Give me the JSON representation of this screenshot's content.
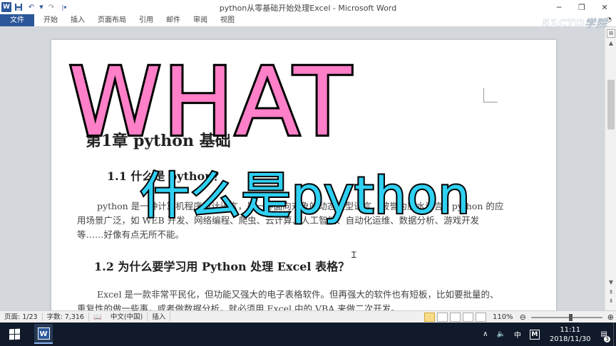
{
  "window": {
    "title": "python从零基础开始处理Excel - Microsoft Word",
    "qat_icons": [
      "word-logo-icon",
      "save-icon",
      "undo-icon",
      "redo-icon",
      "customize-qat-icon"
    ],
    "controls": {
      "minimize": "─",
      "restore": "❐",
      "close": "✕"
    }
  },
  "ribbon": {
    "tabs": [
      "文件",
      "开始",
      "插入",
      "页面布局",
      "引用",
      "邮件",
      "审阅",
      "视图"
    ]
  },
  "document": {
    "heading1": "第1章 python 基础",
    "heading2": "1.1 什么是 python？",
    "para1": "python 是一种计算机程序设计语言，是一种面向对象的动态类型语言，被誉为胶水语言。python 的应用场景广泛，如 WEB 开发、网络编程、爬虫、云计算、人工智能、自动化运维、数据分析、游戏开发等……好像有点无所不能。",
    "heading3": "1.2 为什么要学习用 Python 处理 Excel 表格？",
    "para2": "Excel 是一款非常平民化，但功能又强大的电子表格软件。但再强大的软件也有短板，比如要批量的、重复性的做一些事，或者做数据分析，就必须用 Excel 中的 VBA 来做二次开发。"
  },
  "overlay": {
    "big": "WHAT",
    "sub": "什么是python"
  },
  "watermark": "51CTO学院",
  "statusbar": {
    "page": "页面: 1/23",
    "words": "字数: 7,316",
    "language": "中文(中国)",
    "mode": "插入",
    "zoom": "110%",
    "zoom_fraction": 0.55
  },
  "taskbar": {
    "tray_up": "∧",
    "ime": "中",
    "ime_mode": "M",
    "time": "11:11",
    "date": "2018/11/30",
    "notifications": "3"
  }
}
